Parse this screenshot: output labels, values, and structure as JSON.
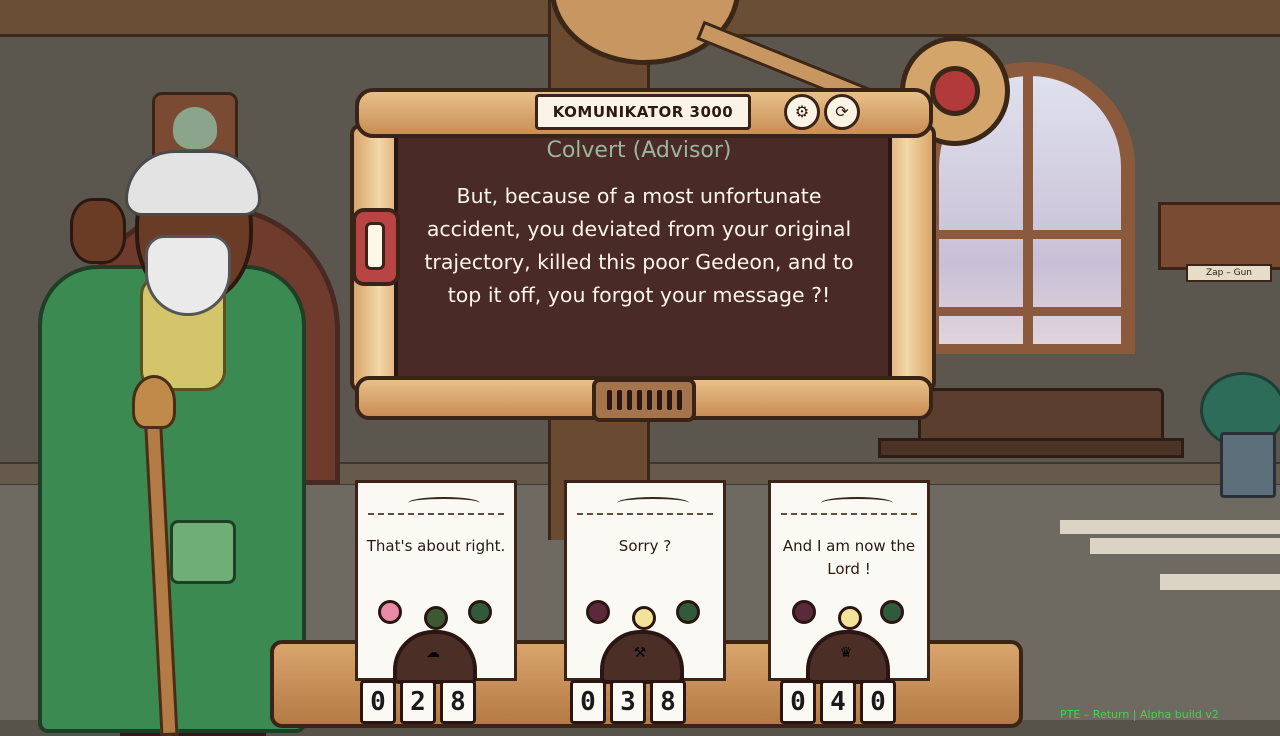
{
  "komunikator": {
    "title": "KOMUNIKATOR 3000",
    "settings_icon": "gear-icon",
    "restart_icon": "refresh-icon"
  },
  "dialogue": {
    "speaker": "Colvert (Advisor)",
    "text": "But, because of a most unfortunate accident, you deviated from your original trajectory, killed this poor Gedeon, and to top it off, you forgot your message ?!"
  },
  "choices": [
    {
      "text": "That's about right.",
      "counter": [
        "0",
        "2",
        "8"
      ],
      "dome_icon": "cloud-icon",
      "bulb_colors": [
        "#e98aa6",
        "#3c5a32",
        "#2f5a3c"
      ]
    },
    {
      "text": "Sorry ?",
      "counter": [
        "0",
        "3",
        "8"
      ],
      "dome_icon": "dumbbell-icon",
      "bulb_colors": [
        "#5a2a3a",
        "#f2e29a",
        "#2f5a3c"
      ]
    },
    {
      "text": "And I am now the Lord !",
      "counter": [
        "0",
        "4",
        "0"
      ],
      "dome_icon": "crown-icon",
      "bulb_colors": [
        "#5a2a3a",
        "#f2e29a",
        "#2f5a3c"
      ]
    }
  ],
  "wall_sign": {
    "label": "Zap – Gun"
  },
  "build_info": "PTE – Return | Alpha build v2"
}
